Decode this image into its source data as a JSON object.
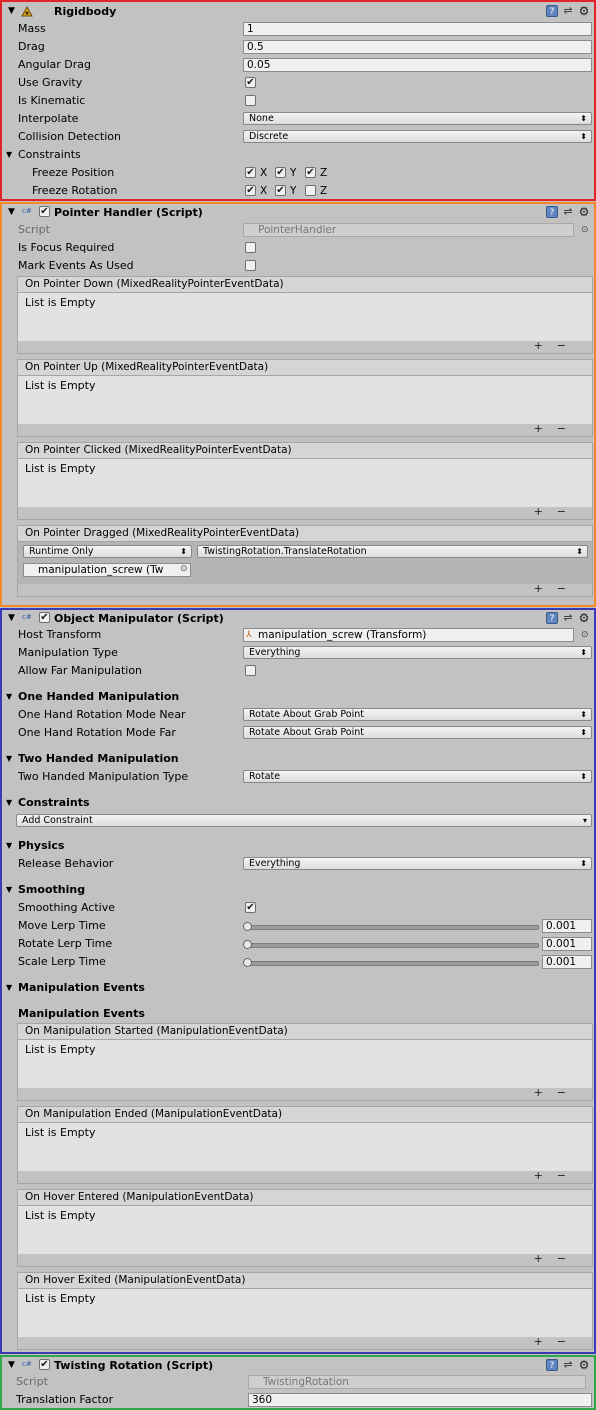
{
  "rigidbody": {
    "title": "Rigidbody",
    "border_color": "#e0242a",
    "mass_label": "Mass",
    "mass_value": "1",
    "drag_label": "Drag",
    "drag_value": "0.5",
    "angular_drag_label": "Angular Drag",
    "angular_drag_value": "0.05",
    "use_gravity_label": "Use Gravity",
    "use_gravity": true,
    "is_kinematic_label": "Is Kinematic",
    "is_kinematic": false,
    "interpolate_label": "Interpolate",
    "interpolate_value": "None",
    "collision_label": "Collision Detection",
    "collision_value": "Discrete",
    "constraints_label": "Constraints",
    "freeze_position_label": "Freeze Position",
    "freeze_rotation_label": "Freeze Rotation",
    "axis_x": "X",
    "axis_y": "Y",
    "axis_z": "Z",
    "freeze_position": [
      true,
      true,
      true
    ],
    "freeze_rotation": [
      true,
      true,
      false
    ]
  },
  "pointer_handler": {
    "title": "Pointer Handler (Script)",
    "border_color": "#f08a2a",
    "script_label": "Script",
    "script_value": "PointerHandler",
    "focus_label": "Is Focus Required",
    "focus": false,
    "mark_label": "Mark Events As Used",
    "mark": false,
    "events": [
      {
        "title": "On Pointer Down (MixedRealityPointerEventData)",
        "empty": "List is Empty"
      },
      {
        "title": "On Pointer Up (MixedRealityPointerEventData)",
        "empty": "List is Empty"
      },
      {
        "title": "On Pointer Clicked (MixedRealityPointerEventData)",
        "empty": "List is Empty"
      }
    ],
    "dragged": {
      "title": "On Pointer Dragged (MixedRealityPointerEventData)",
      "mode": "Runtime Only",
      "method": "TwistingRotation.TranslateRotation",
      "object": "manipulation_screw (Tw"
    }
  },
  "object_manipulator": {
    "title": "Object Manipulator (Script)",
    "border_color": "#3a3ab8",
    "host_label": "Host Transform",
    "host_value": "manipulation_screw (Transform)",
    "type_label": "Manipulation Type",
    "type_value": "Everything",
    "far_label": "Allow Far Manipulation",
    "far": false,
    "one_hand_title": "One Handed Manipulation",
    "near_label": "One Hand Rotation Mode Near",
    "near_value": "Rotate About Grab Point",
    "far_mode_label": "One Hand Rotation Mode Far",
    "far_mode_value": "Rotate About Grab Point",
    "two_hand_title": "Two Handed Manipulation",
    "two_type_label": "Two Handed Manipulation Type",
    "two_type_value": "Rotate",
    "constraints_title": "Constraints",
    "add_constraint": "Add Constraint",
    "physics_title": "Physics",
    "release_label": "Release Behavior",
    "release_value": "Everything",
    "smoothing_title": "Smoothing",
    "smoothing_active_label": "Smoothing Active",
    "smoothing_active": true,
    "move_label": "Move Lerp Time",
    "move_value": "0.001",
    "move_level": 0.001,
    "rotate_label": "Rotate Lerp Time",
    "rotate_value": "0.001",
    "rotate_level": 0.001,
    "scale_label": "Scale Lerp Time",
    "scale_value": "0.001",
    "scale_level": 0.001,
    "events_title": "Manipulation Events",
    "events_subtitle": "Manipulation Events",
    "events": [
      {
        "title": "On Manipulation Started (ManipulationEventData)",
        "empty": "List is Empty"
      },
      {
        "title": "On Manipulation Ended (ManipulationEventData)",
        "empty": "List is Empty"
      },
      {
        "title": "On Hover Entered (ManipulationEventData)",
        "empty": "List is Empty"
      },
      {
        "title": "On Hover Exited (ManipulationEventData)",
        "empty": "List is Empty"
      }
    ]
  },
  "twisting_rotation": {
    "title": "Twisting Rotation (Script)",
    "border_color": "#2fa84a",
    "script_label": "Script",
    "script_value": "TwistingRotation",
    "factor_label": "Translation Factor",
    "factor_value": "360"
  },
  "icons": {
    "fold": "triangle-down-icon",
    "help": "help-icon",
    "preset": "preset-icon",
    "settings": "gear-icon",
    "script": "csharp-script-icon",
    "rigidbody": "rigidbody-icon",
    "transform": "transform-icon",
    "object_picker": "object-picker-icon"
  },
  "checkmark": "✔"
}
